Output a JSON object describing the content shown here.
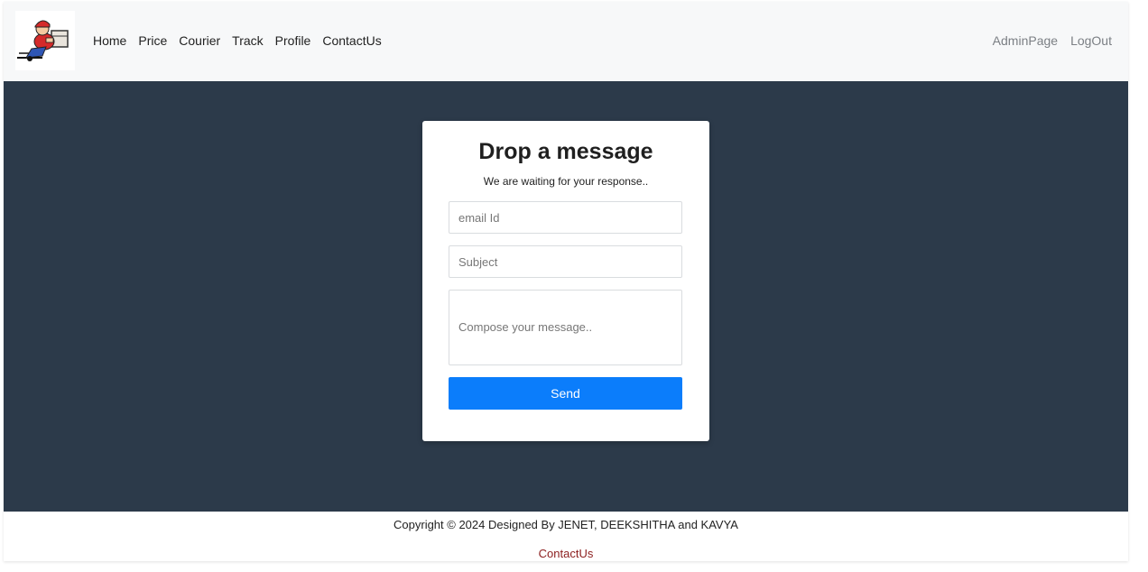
{
  "nav": {
    "logo_icon": "courier-delivery-logo-icon",
    "left_links": [
      "Home",
      "Price",
      "Courier",
      "Track",
      "Profile",
      "ContactUs"
    ],
    "right_links": [
      "AdminPage",
      "LogOut"
    ]
  },
  "contact_form": {
    "title": "Drop a message",
    "subtitle": "We are waiting for your response..",
    "email_placeholder": "email Id",
    "subject_placeholder": "Subject",
    "message_placeholder": "Compose your message..",
    "send_label": "Send"
  },
  "footer": {
    "copyright": "Copyright © 2024 Designed By JENET, DEEKSHITHA and KAVYA",
    "link": "ContactUs"
  },
  "colors": {
    "hero_bg": "#2c3a4a",
    "button": "#0b7dfb",
    "footer_link": "#8b1d1d"
  }
}
